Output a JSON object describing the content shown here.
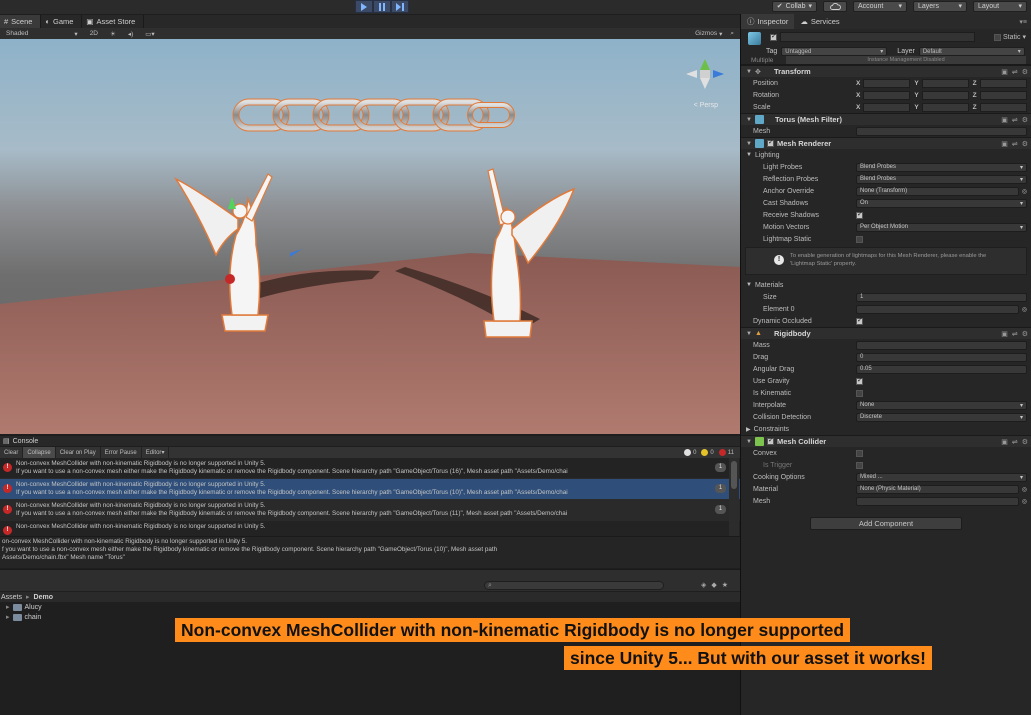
{
  "toolbar": {
    "collab": "Collab",
    "account": "Account",
    "layers": "Layers",
    "layout": "Layout"
  },
  "tabs": {
    "scene": "Scene",
    "game": "Game",
    "asset_store": "Asset Store"
  },
  "scene_toolbar": {
    "shading": "Shaded",
    "mode_2d": "2D",
    "gizmos": "Gizmos"
  },
  "viewport": {
    "persp": "< Persp"
  },
  "console": {
    "title": "Console",
    "buttons": [
      "Clear",
      "Collapse",
      "Clear on Play",
      "Error Pause",
      "Editor"
    ],
    "info_count": "0",
    "warn_count": "0",
    "error_count": "11",
    "entries": [
      {
        "line1": "Non-convex MeshCollider with non-kinematic Rigidbody is no longer supported in Unity 5.",
        "line2": "If you want to use a non-convex mesh either make the Rigidbody kinematic or remove the Rigidbody component. Scene hierarchy path \"GameObject/Torus (16)\", Mesh asset path \"Assets/Demo/chai",
        "count": "1"
      },
      {
        "line1": "Non-convex MeshCollider with non-kinematic Rigidbody is no longer supported in Unity 5.",
        "line2": "If you want to use a non-convex mesh either make the Rigidbody kinematic or remove the Rigidbody component. Scene hierarchy path \"GameObject/Torus (10)\", Mesh asset path \"Assets/Demo/chai",
        "count": "1"
      },
      {
        "line1": "Non-convex MeshCollider with non-kinematic Rigidbody is no longer supported in Unity 5.",
        "line2": "If you want to use a non-convex mesh either make the Rigidbody kinematic or remove the Rigidbody component. Scene hierarchy path \"GameObject/Torus (11)\", Mesh asset path \"Assets/Demo/chai",
        "count": "1"
      },
      {
        "line1": "Non-convex MeshCollider with non-kinematic Rigidbody is no longer supported in Unity 5.",
        "line2": "",
        "count": ""
      }
    ],
    "detail_lines": [
      "on-convex MeshCollider with non-kinematic Rigidbody is no longer supported in Unity 5.",
      "f you want to use a non-convex mesh either make the Rigidbody kinematic or remove the Rigidbody component. Scene hierarchy path \"GameObject/Torus (10)\", Mesh asset path",
      "Assets/Demo/chain.fbx\" Mesh name \"Torus\""
    ]
  },
  "project": {
    "breadcrumb": [
      "Assets",
      "Demo"
    ],
    "items": [
      "Alucy",
      "chain"
    ]
  },
  "inspector": {
    "tab_inspector": "Inspector",
    "tab_services": "Services",
    "static": "Static",
    "tag_label": "Tag",
    "tag_value": "Untagged",
    "layer_label": "Layer",
    "layer_value": "Default",
    "multiple": "Multiple",
    "prefab_note": "Instance Management Disabled",
    "transform": {
      "title": "Transform",
      "position": "Position",
      "rotation": "Rotation",
      "scale": "Scale",
      "x": "X",
      "y": "Y",
      "z": "Z"
    },
    "mesh_filter": {
      "title": "Torus (Mesh Filter)",
      "mesh_label": "Mesh"
    },
    "mesh_renderer": {
      "title": "Mesh Renderer",
      "lighting": "Lighting",
      "light_probes": "Light Probes",
      "light_probes_val": "Blend Probes",
      "reflection_probes": "Reflection Probes",
      "reflection_probes_val": "Blend Probes",
      "anchor_override": "Anchor Override",
      "anchor_override_val": "None (Transform)",
      "cast_shadows": "Cast Shadows",
      "cast_shadows_val": "On",
      "receive_shadows": "Receive Shadows",
      "motion_vectors": "Motion Vectors",
      "motion_vectors_val": "Per Object Motion",
      "lightmap_static": "Lightmap Static",
      "warning_line1": "To enable generation of lightmaps for this Mesh Renderer, please enable the",
      "warning_line2": "'Lightmap Static' property.",
      "materials": "Materials",
      "size": "Size",
      "size_val": "1",
      "element0": "Element 0",
      "dynamic_occluded": "Dynamic Occluded"
    },
    "rigidbody": {
      "title": "Rigidbody",
      "mass": "Mass",
      "drag": "Drag",
      "drag_val": "0",
      "angular_drag": "Angular Drag",
      "angular_drag_val": "0.05",
      "use_gravity": "Use Gravity",
      "is_kinematic": "Is Kinematic",
      "interpolate": "Interpolate",
      "interpolate_val": "None",
      "collision_detection": "Collision Detection",
      "collision_detection_val": "Discrete",
      "constraints": "Constraints"
    },
    "mesh_collider": {
      "title": "Mesh Collider",
      "convex": "Convex",
      "is_trigger": "Is Trigger",
      "cooking_options": "Cooking Options",
      "cooking_options_val": "Mixed ...",
      "material": "Material",
      "material_val": "None (Physic Material)",
      "mesh": "Mesh"
    },
    "add_component": "Add Component"
  },
  "banner": {
    "line1": "Non-convex MeshCollider with non-kinematic Rigidbody is no longer supported",
    "line2": "since Unity 5... But with our asset it works!"
  },
  "colors": {
    "banner": "#ff8c1a",
    "error": "#c62828",
    "selected_row": "#2f4f7a",
    "play_button": "#3c4a66"
  }
}
